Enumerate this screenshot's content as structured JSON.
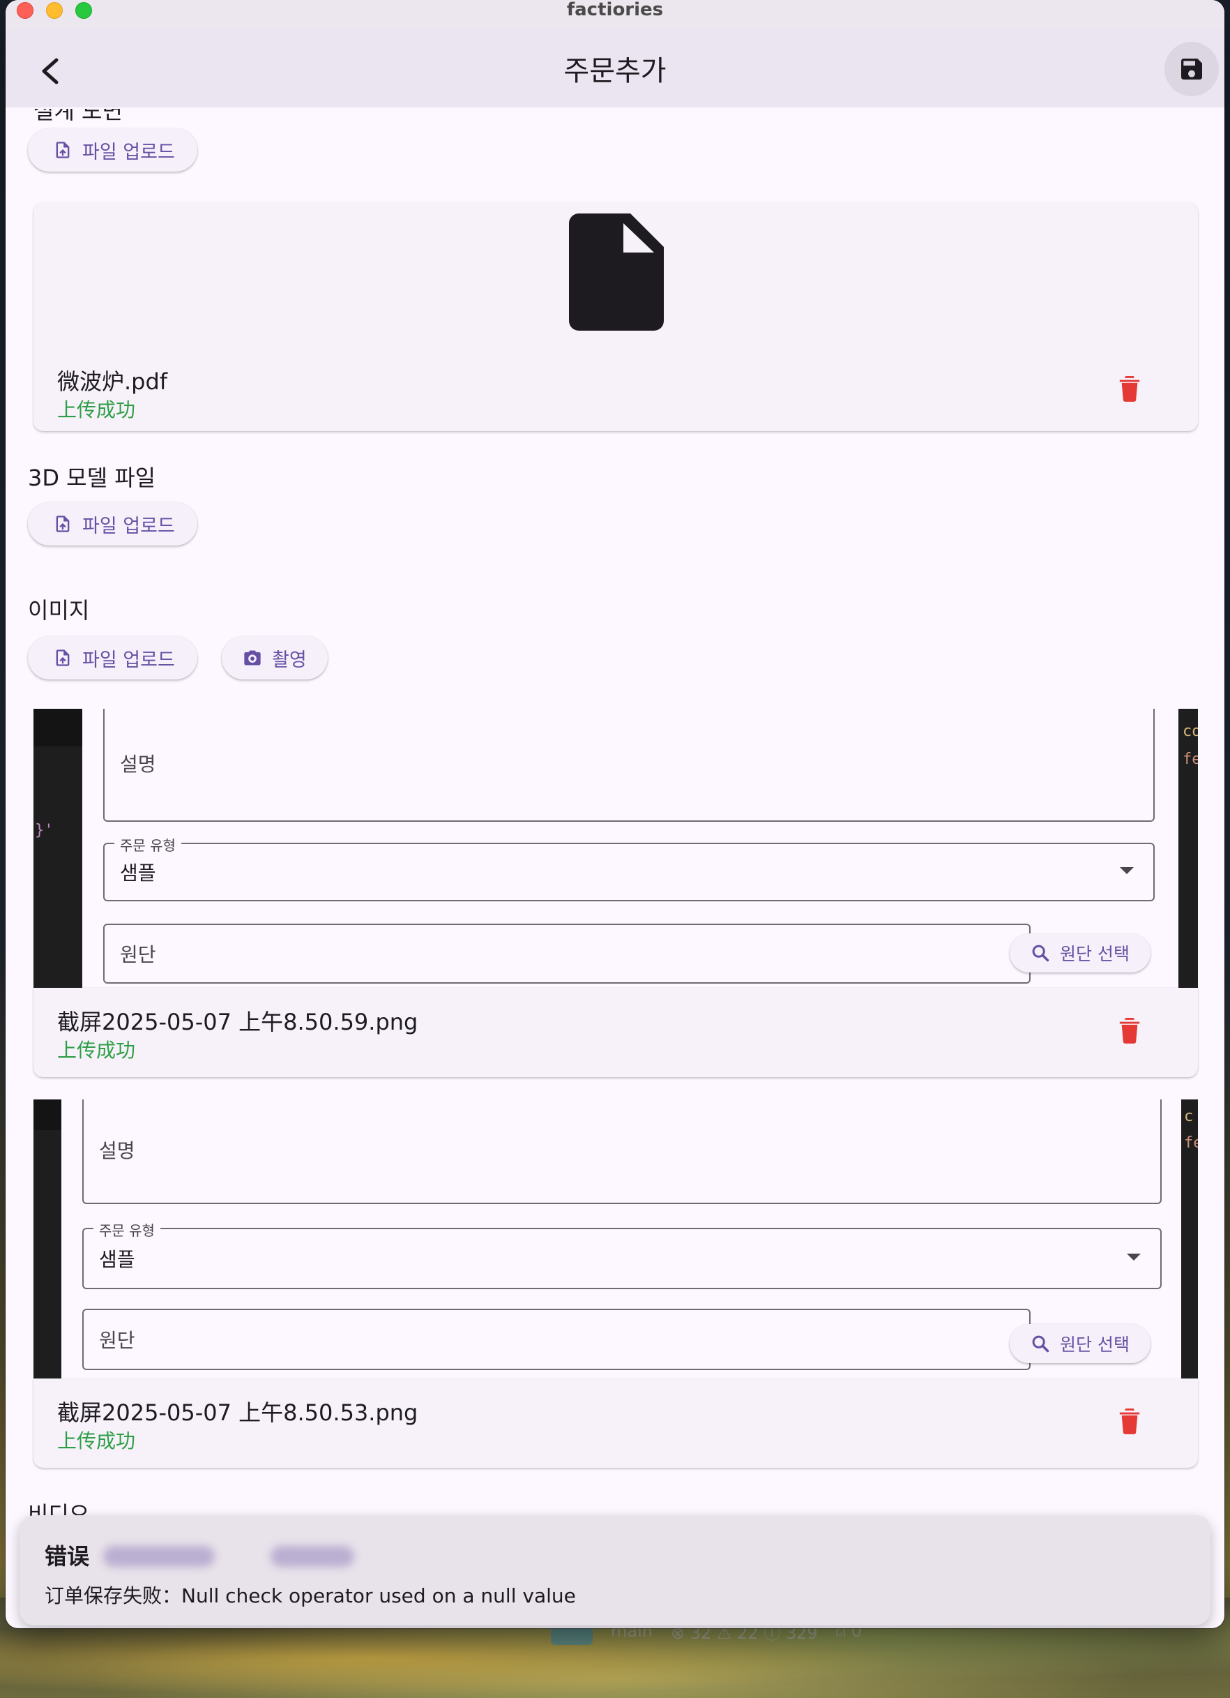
{
  "window": {
    "title": "factiories"
  },
  "appbar": {
    "title": "주문추가",
    "back_icon": "arrow-back-icon",
    "save_icon": "floppy-save-icon"
  },
  "sections": {
    "top_partial_label": "설계 도면",
    "model_label": "3D 모델 파일",
    "image_label": "이미지",
    "video_partial_label": "비디오"
  },
  "buttons": {
    "upload": "파일 업로드",
    "capture": "촬영",
    "fabric_select": "원단 선택"
  },
  "files": {
    "drawing": {
      "name": "微波炉.pdf",
      "status": "上传成功"
    },
    "image1": {
      "name": "截屏2025-05-07 上午8.50.59.png",
      "status": "上传成功"
    },
    "image2": {
      "name": "截屏2025-05-07 上午8.50.53.png",
      "status": "上传成功"
    }
  },
  "form": {
    "description_placeholder": "설명",
    "order_type_label": "주문 유형",
    "order_type_value": "샘플",
    "fabric_placeholder": "원단"
  },
  "snackbar": {
    "title": "错误",
    "message": "订单保存失败：Null check operator used on a null value"
  },
  "background_statusbar": {
    "branch": "main",
    "counts": "⊗ 32 ⚠ 22 ⓘ 329",
    "ports": "⍝ 0"
  },
  "colors": {
    "accent": "#6750a4",
    "success": "#2e9e46",
    "danger": "#e53935",
    "surface": "#fdf7ff"
  }
}
